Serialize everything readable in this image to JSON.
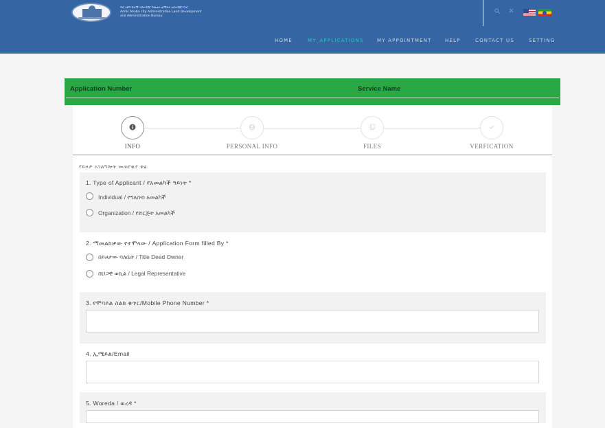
{
  "header": {
    "org_lines": [
      "ፍሰ አበባ ከተማ አስተዳደር የመሬት ልማትና አስተዳደር ቢሮ",
      "Addis Ababa city Administration Land Development",
      "and Administration Bureau"
    ],
    "icons": [
      "search-icon",
      "close-icon"
    ],
    "flags": [
      "flag-us",
      "flag-ethiopia"
    ],
    "nav": [
      {
        "label": "HOME"
      },
      {
        "label": "MY_APPLICATIONS"
      },
      {
        "label": "MY APPOINTMENT"
      },
      {
        "label": "HELP"
      },
      {
        "label": "CONTACT US"
      },
      {
        "label": "SETTING"
      }
    ],
    "active_nav": "MY_APPLICATIONS",
    "colors": {
      "header_bg": "#3566a3",
      "active_nav": "#2fc4c0"
    }
  },
  "application_bar": {
    "application_number_label": "Application Number",
    "service_name_label": "Service Name",
    "color": "#2aa845"
  },
  "steps": [
    {
      "label": "INFO",
      "icon": "info-icon",
      "active": true
    },
    {
      "label": "PERSONAL INFO",
      "icon": "user-icon",
      "active": false
    },
    {
      "label": "FILES",
      "icon": "files-icon",
      "active": false
    },
    {
      "label": "VERFICATION",
      "icon": "check-icon",
      "active": false
    }
  ],
  "form": {
    "subheading": "የይዞታ አገልግሎት መጠየቂያ ቅፅ",
    "q1": {
      "title": "1. Type of Applicant / የአመልካች ዓይነት *",
      "options": [
        "Individual / የግለሰብ አመልካች",
        "Organization / የድርጅት አመልካች"
      ]
    },
    "q2": {
      "title": "2. ማመልከቻው የተሞላው / Application Form filled By *",
      "options": [
        "በይዞታው ባለቤት / Title Deed Owner",
        "በህጋዊ ወኪል / Legal Representative"
      ]
    },
    "q3": {
      "title": "3. የሞባይል ስልክ ቁጥር/Mobile Phone Number *",
      "value": ""
    },
    "q4": {
      "title": "4. ኢሜይል/Email",
      "value": ""
    },
    "q5": {
      "title": "5. Woreda / ወረዳ *",
      "value": ""
    }
  }
}
